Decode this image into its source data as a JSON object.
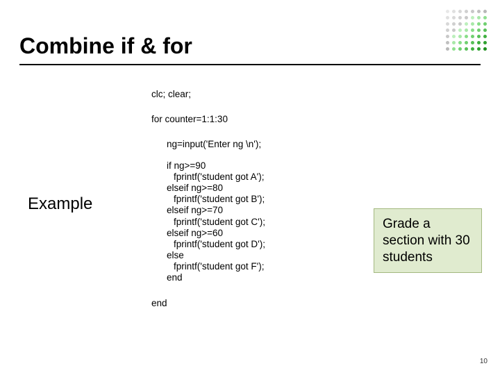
{
  "title": "Combine if & for",
  "label": "Example",
  "code": {
    "l1": "clc; clear;",
    "l2": "for counter=1:1:30",
    "l3": "ng=input('Enter ng \\n');",
    "l4": "if  ng>=90",
    "l5": "fprintf('student got A');",
    "l6": "elseif ng>=80",
    "l7": "fprintf('student got B');",
    "l8": "elseif ng>=70",
    "l9": "fprintf('student got C');",
    "l10": "elseif ng>=60",
    "l11": "fprintf('student got D');",
    "l12": "else",
    "l13": "fprintf('student got F');",
    "l14": "end",
    "l15": "end"
  },
  "callout": "Grade a section with 30 students",
  "page": "10",
  "dotColors": [
    "#e8e8e8",
    "#e0e0e0",
    "#d8d8d8",
    "#d0d0d0",
    "#c8c8c8",
    "#c0c0c0",
    "#b8b8b8",
    "#e0e0e0",
    "#d8d8d8",
    "#d0d0d0",
    "#c8c8c8",
    "#bcf0bc",
    "#a8e8a8",
    "#90e090",
    "#d8d8d8",
    "#d0d0d0",
    "#c8c8c8",
    "#bcf0bc",
    "#a8e8a8",
    "#88dd88",
    "#70d070",
    "#d0d0d0",
    "#c8c8c8",
    "#bcf0bc",
    "#a8e8a8",
    "#88dd88",
    "#70d070",
    "#58c058",
    "#c8c8c8",
    "#bcf0bc",
    "#a8e8a8",
    "#88dd88",
    "#70d070",
    "#58c058",
    "#40b040",
    "#c0c0c0",
    "#a8e8a8",
    "#88dd88",
    "#70d070",
    "#58c058",
    "#40b040",
    "#2fa02f",
    "#b8b8b8",
    "#90e090",
    "#70d070",
    "#58c058",
    "#40b040",
    "#2fa02f",
    "#1f901f"
  ]
}
